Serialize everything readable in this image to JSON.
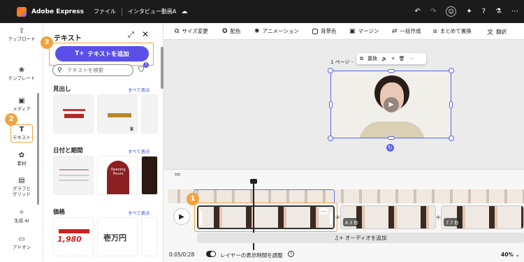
{
  "app": {
    "name": "Adobe Express",
    "file_menu": "ファイル",
    "doc_title": "インタビュー動画A"
  },
  "topbar_icons": [
    "undo-icon",
    "redo-icon",
    "account-icon",
    "lightbulb-icon",
    "help-icon",
    "lab-icon",
    "more-icon"
  ],
  "rail": {
    "items": [
      {
        "label": "アップロード",
        "icon": "upload-icon"
      },
      {
        "label": "テンプレート",
        "icon": "template-icon"
      },
      {
        "label": "メディア",
        "icon": "media-icon"
      },
      {
        "label": "テキスト",
        "icon": "text-icon"
      },
      {
        "label": "素材",
        "icon": "elements-icon"
      },
      {
        "label": "グラフとグリッド",
        "icon": "grid-icon"
      },
      {
        "label": "生成 AI",
        "icon": "ai-icon"
      },
      {
        "label": "アドオン",
        "icon": "addon-icon"
      }
    ],
    "active": "テキスト"
  },
  "panel": {
    "title": "テキスト",
    "add_text_label": "テキストを追加",
    "search_placeholder": "テキストを検索",
    "filter_count": "2",
    "sections": [
      {
        "title": "見出し",
        "see_all": "すべて表示"
      },
      {
        "title": "日付と期間",
        "see_all": "すべて表示"
      },
      {
        "title": "価格",
        "see_all": "すべて表示"
      }
    ],
    "tile_texts": {
      "date_card": "Opening Hours",
      "price1": "1,980",
      "price2": "壱万円"
    }
  },
  "toolbar": {
    "items": [
      "サイズ変更",
      "配色",
      "アニメーション",
      "背景色",
      "マージン",
      "一括作成",
      "まとめて置換",
      "翻訳"
    ]
  },
  "canvas": {
    "page_label": "1 ページ -",
    "float_bar_replace": "置換"
  },
  "timeline": {
    "clip_durations": [
      "8.3 秒",
      "7.7 秒"
    ],
    "add_audio": "オーディオを追加",
    "time": "0:05/0:28",
    "toggle_label": "レイヤーの表示時間を調整",
    "zoom": "40%"
  },
  "steps": [
    "1",
    "2",
    "3"
  ],
  "colors": {
    "accent": "#5a50e8",
    "step": "#f0a340",
    "selection": "#5a63e8"
  }
}
